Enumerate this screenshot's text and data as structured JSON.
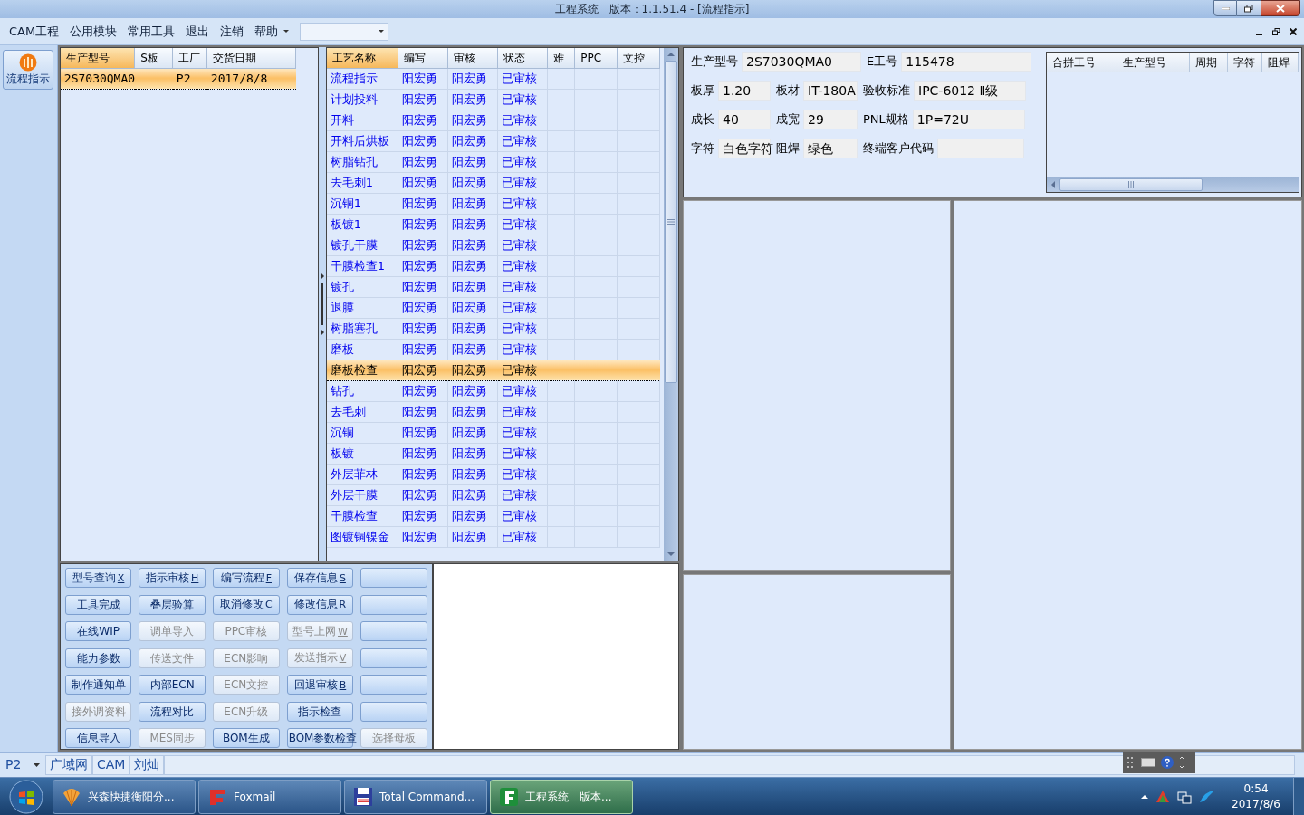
{
  "window": {
    "title": "工程系统　版本：1.1.51.4 - [流程指示]"
  },
  "menu": [
    {
      "label": "CAM工程",
      "dropdown": false
    },
    {
      "label": "公用模块",
      "dropdown": false
    },
    {
      "label": "常用工具",
      "dropdown": false
    },
    {
      "label": "退出",
      "dropdown": false
    },
    {
      "label": "注销",
      "dropdown": false
    },
    {
      "label": "帮助",
      "dropdown": true
    }
  ],
  "nav": [
    {
      "label": "流程指示",
      "selected": true
    }
  ],
  "order_grid": {
    "columns": [
      {
        "label": "生产型号",
        "selected": true
      },
      {
        "label": "S板",
        "selected": false
      },
      {
        "label": "工厂",
        "selected": false
      },
      {
        "label": "交货日期",
        "selected": false
      }
    ],
    "rows": [
      {
        "cells": [
          "2S7030QMA0",
          null,
          "P2",
          "2017/8/8"
        ],
        "selected": true
      }
    ]
  },
  "process_grid": {
    "columns": [
      {
        "label": "工艺名称",
        "selected": true
      },
      {
        "label": "编写",
        "selected": false
      },
      {
        "label": "审核",
        "selected": false
      },
      {
        "label": "状态",
        "selected": false
      },
      {
        "label": "难",
        "selected": false
      },
      {
        "label": "PPC",
        "selected": false
      },
      {
        "label": "文控",
        "selected": false
      }
    ],
    "rows": [
      {
        "cells": [
          "流程指示",
          "阳宏勇",
          "阳宏勇",
          "已审核"
        ],
        "selected": false
      },
      {
        "cells": [
          "计划投料",
          "阳宏勇",
          "阳宏勇",
          "已审核"
        ],
        "selected": false
      },
      {
        "cells": [
          "开料",
          "阳宏勇",
          "阳宏勇",
          "已审核"
        ],
        "selected": false
      },
      {
        "cells": [
          "开料后烘板",
          "阳宏勇",
          "阳宏勇",
          "已审核"
        ],
        "selected": false
      },
      {
        "cells": [
          "树脂钻孔",
          "阳宏勇",
          "阳宏勇",
          "已审核"
        ],
        "selected": false
      },
      {
        "cells": [
          "去毛刺1",
          "阳宏勇",
          "阳宏勇",
          "已审核"
        ],
        "selected": false
      },
      {
        "cells": [
          "沉铜1",
          "阳宏勇",
          "阳宏勇",
          "已审核"
        ],
        "selected": false
      },
      {
        "cells": [
          "板镀1",
          "阳宏勇",
          "阳宏勇",
          "已审核"
        ],
        "selected": false
      },
      {
        "cells": [
          "镀孔干膜",
          "阳宏勇",
          "阳宏勇",
          "已审核"
        ],
        "selected": false
      },
      {
        "cells": [
          "干膜检查1",
          "阳宏勇",
          "阳宏勇",
          "已审核"
        ],
        "selected": false
      },
      {
        "cells": [
          "镀孔",
          "阳宏勇",
          "阳宏勇",
          "已审核"
        ],
        "selected": false
      },
      {
        "cells": [
          "退膜",
          "阳宏勇",
          "阳宏勇",
          "已审核"
        ],
        "selected": false
      },
      {
        "cells": [
          "树脂塞孔",
          "阳宏勇",
          "阳宏勇",
          "已审核"
        ],
        "selected": false
      },
      {
        "cells": [
          "磨板",
          "阳宏勇",
          "阳宏勇",
          "已审核"
        ],
        "selected": false
      },
      {
        "cells": [
          "磨板检查",
          "阳宏勇",
          "阳宏勇",
          "已审核"
        ],
        "selected": true
      },
      {
        "cells": [
          "钻孔",
          "阳宏勇",
          "阳宏勇",
          "已审核"
        ],
        "selected": false
      },
      {
        "cells": [
          "去毛刺",
          "阳宏勇",
          "阳宏勇",
          "已审核"
        ],
        "selected": false
      },
      {
        "cells": [
          "沉铜",
          "阳宏勇",
          "阳宏勇",
          "已审核"
        ],
        "selected": false
      },
      {
        "cells": [
          "板镀",
          "阳宏勇",
          "阳宏勇",
          "已审核"
        ],
        "selected": false
      },
      {
        "cells": [
          "外层菲林",
          "阳宏勇",
          "阳宏勇",
          "已审核"
        ],
        "selected": false
      },
      {
        "cells": [
          "外层干膜",
          "阳宏勇",
          "阳宏勇",
          "已审核"
        ],
        "selected": false
      },
      {
        "cells": [
          "干膜检查",
          "阳宏勇",
          "阳宏勇",
          "已审核"
        ],
        "selected": false
      },
      {
        "cells": [
          "图镀铜镍金",
          "阳宏勇",
          "阳宏勇",
          "已审核"
        ],
        "selected": false
      }
    ]
  },
  "actions": [
    [
      {
        "label": "型号查询",
        "shortcut": "X",
        "disabled": false
      },
      {
        "label": "指示审核",
        "shortcut": "H",
        "disabled": false
      },
      {
        "label": "编写流程",
        "shortcut": "F",
        "disabled": false
      },
      {
        "label": "保存信息",
        "shortcut": "S",
        "disabled": false
      },
      {
        "disabled": false
      }
    ],
    [
      {
        "label": "工具完成",
        "disabled": false
      },
      {
        "label": "叠层验算",
        "disabled": false
      },
      {
        "label": "取消修改",
        "shortcut": "C",
        "disabled": false
      },
      {
        "label": "修改信息",
        "shortcut": "R",
        "disabled": false
      },
      {
        "disabled": false
      }
    ],
    [
      {
        "label": "在线WIP",
        "disabled": false
      },
      {
        "label": "调单导入",
        "disabled": true
      },
      {
        "label": "PPC审核",
        "disabled": true
      },
      {
        "label": "型号上网",
        "shortcut": "W",
        "disabled": true
      },
      {
        "disabled": false
      }
    ],
    [
      {
        "label": "能力参数",
        "disabled": false
      },
      {
        "label": "传送文件",
        "disabled": true
      },
      {
        "label": "ECN影响",
        "disabled": true
      },
      {
        "label": "发送指示",
        "shortcut": "V",
        "disabled": true
      },
      {
        "disabled": false
      }
    ],
    [
      {
        "label": "制作通知单",
        "disabled": false
      },
      {
        "label": "内部ECN",
        "disabled": false
      },
      {
        "label": "ECN文控",
        "disabled": true
      },
      {
        "label": "回退审核",
        "shortcut": "B",
        "disabled": false
      },
      {
        "disabled": false
      }
    ],
    [
      {
        "label": "接外调资料",
        "disabled": true
      },
      {
        "label": "流程对比",
        "disabled": false
      },
      {
        "label": "ECN升级",
        "disabled": true
      },
      {
        "label": "指示检查",
        "disabled": false
      },
      {
        "disabled": false
      }
    ],
    [
      {
        "label": "信息导入",
        "disabled": false
      },
      {
        "label": "MES同步",
        "disabled": true
      },
      {
        "label": "BOM生成",
        "disabled": false
      },
      {
        "label": "BOM参数检查",
        "disabled": false
      },
      {
        "label": "选择母板",
        "disabled": true
      }
    ]
  ],
  "info": [
    [
      {
        "label": "生产型号",
        "value": "2S7030QMA0"
      },
      {
        "label": "E工号",
        "value": "115478"
      }
    ],
    [
      {
        "label": "板厚",
        "value": "1.20"
      },
      {
        "label": "板材",
        "value": "IT-180A"
      },
      {
        "label": "验收标准",
        "value": "IPC-6012 Ⅱ级"
      }
    ],
    [
      {
        "label": "成长",
        "value": "40"
      },
      {
        "label": "成宽",
        "value": "29"
      },
      {
        "label": "PNL规格",
        "value": "1P=72U"
      }
    ],
    [
      {
        "label": "字符",
        "value": "白色字符"
      },
      {
        "label": "阻焊",
        "value": "绿色"
      },
      {
        "label": "终端客户代码"
      }
    ]
  ],
  "merge_grid": {
    "columns": [
      "合拼工号",
      "生产型号",
      "周期",
      "字符",
      "阻焊"
    ]
  },
  "status_bar": {
    "plant": "P2",
    "items": [
      "广域网",
      "CAM",
      "刘灿"
    ]
  },
  "taskbar": {
    "tasks": [
      {
        "label": "兴森快捷衡阳分...",
        "selected": false
      },
      {
        "label": "Foxmail",
        "selected": false
      },
      {
        "label": "Total Command...",
        "selected": false
      },
      {
        "label": "工程系统　版本...",
        "selected": true
      }
    ],
    "time": "0:54",
    "date": "2017/8/6"
  }
}
